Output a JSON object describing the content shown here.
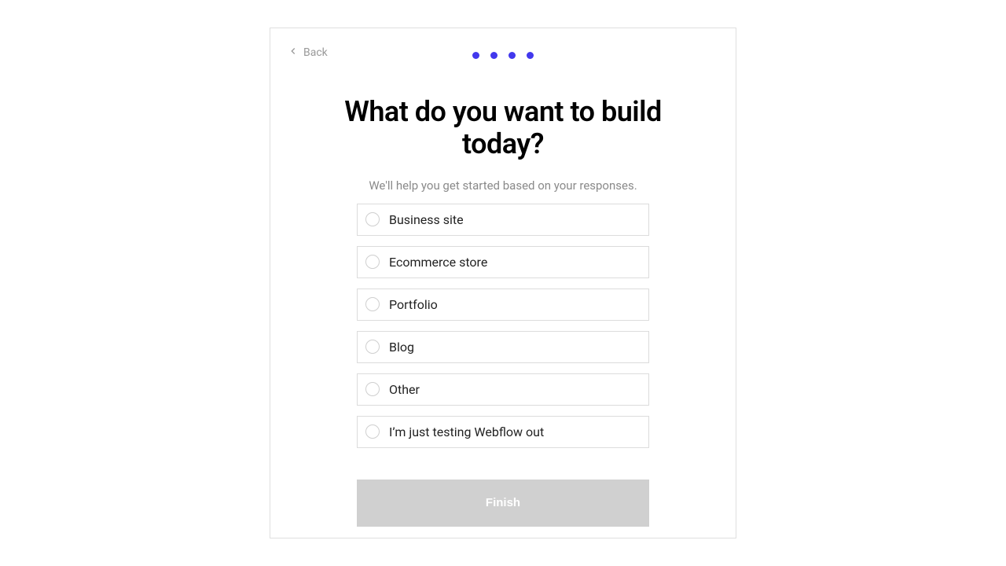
{
  "nav": {
    "back_label": "Back"
  },
  "progress": {
    "total_steps": 4,
    "current_step": 4,
    "dot_color": "#4238ed"
  },
  "heading": "What do you want to build today?",
  "subtitle": "We'll help you get started based on your responses.",
  "options": [
    {
      "label": "Business site"
    },
    {
      "label": "Ecommerce store"
    },
    {
      "label": "Portfolio"
    },
    {
      "label": "Blog"
    },
    {
      "label": "Other"
    },
    {
      "label": "I’m just testing Webflow out"
    }
  ],
  "actions": {
    "finish_label": "Finish"
  }
}
